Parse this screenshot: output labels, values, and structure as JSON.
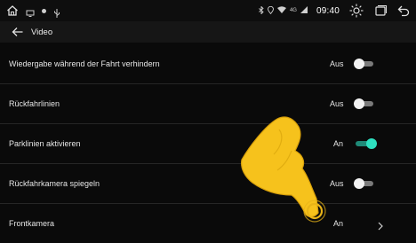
{
  "status_bar": {
    "left_icons": [
      "home-icon",
      "screen-cast-icon",
      "usb-icon"
    ],
    "right_icons": [
      "bluetooth-icon",
      "location-icon",
      "wifi-icon"
    ],
    "network": "4G",
    "time": "09:40",
    "controls": [
      "brightness-icon",
      "recent-apps-icon",
      "back-arrow-icon"
    ]
  },
  "app_bar": {
    "title": "Video"
  },
  "settings": [
    {
      "label": "Wiedergabe während der Fahrt verhindern",
      "value": "Aus",
      "control": "toggle",
      "on": false
    },
    {
      "label": "Rückfahrlinien",
      "value": "Aus",
      "control": "toggle",
      "on": false
    },
    {
      "label": "Parklinien aktivieren",
      "value": "An",
      "control": "toggle",
      "on": true
    },
    {
      "label": "Rückfahrkamera spiegeln",
      "value": "Aus",
      "control": "toggle",
      "on": false
    },
    {
      "label": "Frontkamera",
      "value": "An",
      "control": "chevron"
    }
  ],
  "colors": {
    "toggle_on": "#2ee0c0",
    "toggle_off": "#f2f2f2",
    "hand": "#f6c21c"
  }
}
